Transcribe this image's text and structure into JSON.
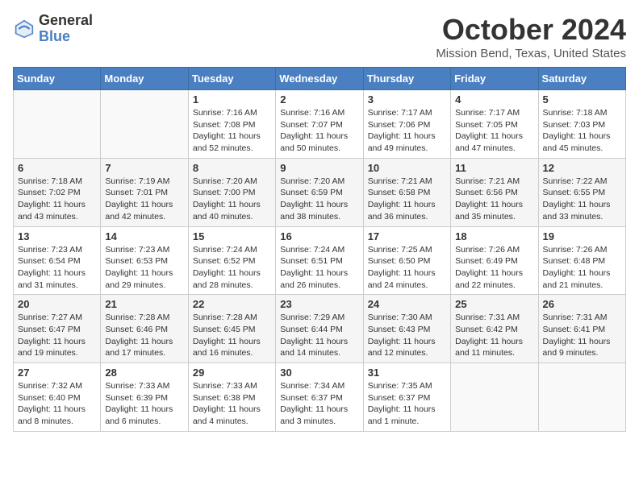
{
  "logo": {
    "general": "General",
    "blue": "Blue"
  },
  "title": "October 2024",
  "subtitle": "Mission Bend, Texas, United States",
  "headers": [
    "Sunday",
    "Monday",
    "Tuesday",
    "Wednesday",
    "Thursday",
    "Friday",
    "Saturday"
  ],
  "weeks": [
    [
      {
        "day": "",
        "sunrise": "",
        "sunset": "",
        "daylight": ""
      },
      {
        "day": "",
        "sunrise": "",
        "sunset": "",
        "daylight": ""
      },
      {
        "day": "1",
        "sunrise": "Sunrise: 7:16 AM",
        "sunset": "Sunset: 7:08 PM",
        "daylight": "Daylight: 11 hours and 52 minutes."
      },
      {
        "day": "2",
        "sunrise": "Sunrise: 7:16 AM",
        "sunset": "Sunset: 7:07 PM",
        "daylight": "Daylight: 11 hours and 50 minutes."
      },
      {
        "day": "3",
        "sunrise": "Sunrise: 7:17 AM",
        "sunset": "Sunset: 7:06 PM",
        "daylight": "Daylight: 11 hours and 49 minutes."
      },
      {
        "day": "4",
        "sunrise": "Sunrise: 7:17 AM",
        "sunset": "Sunset: 7:05 PM",
        "daylight": "Daylight: 11 hours and 47 minutes."
      },
      {
        "day": "5",
        "sunrise": "Sunrise: 7:18 AM",
        "sunset": "Sunset: 7:03 PM",
        "daylight": "Daylight: 11 hours and 45 minutes."
      }
    ],
    [
      {
        "day": "6",
        "sunrise": "Sunrise: 7:18 AM",
        "sunset": "Sunset: 7:02 PM",
        "daylight": "Daylight: 11 hours and 43 minutes."
      },
      {
        "day": "7",
        "sunrise": "Sunrise: 7:19 AM",
        "sunset": "Sunset: 7:01 PM",
        "daylight": "Daylight: 11 hours and 42 minutes."
      },
      {
        "day": "8",
        "sunrise": "Sunrise: 7:20 AM",
        "sunset": "Sunset: 7:00 PM",
        "daylight": "Daylight: 11 hours and 40 minutes."
      },
      {
        "day": "9",
        "sunrise": "Sunrise: 7:20 AM",
        "sunset": "Sunset: 6:59 PM",
        "daylight": "Daylight: 11 hours and 38 minutes."
      },
      {
        "day": "10",
        "sunrise": "Sunrise: 7:21 AM",
        "sunset": "Sunset: 6:58 PM",
        "daylight": "Daylight: 11 hours and 36 minutes."
      },
      {
        "day": "11",
        "sunrise": "Sunrise: 7:21 AM",
        "sunset": "Sunset: 6:56 PM",
        "daylight": "Daylight: 11 hours and 35 minutes."
      },
      {
        "day": "12",
        "sunrise": "Sunrise: 7:22 AM",
        "sunset": "Sunset: 6:55 PM",
        "daylight": "Daylight: 11 hours and 33 minutes."
      }
    ],
    [
      {
        "day": "13",
        "sunrise": "Sunrise: 7:23 AM",
        "sunset": "Sunset: 6:54 PM",
        "daylight": "Daylight: 11 hours and 31 minutes."
      },
      {
        "day": "14",
        "sunrise": "Sunrise: 7:23 AM",
        "sunset": "Sunset: 6:53 PM",
        "daylight": "Daylight: 11 hours and 29 minutes."
      },
      {
        "day": "15",
        "sunrise": "Sunrise: 7:24 AM",
        "sunset": "Sunset: 6:52 PM",
        "daylight": "Daylight: 11 hours and 28 minutes."
      },
      {
        "day": "16",
        "sunrise": "Sunrise: 7:24 AM",
        "sunset": "Sunset: 6:51 PM",
        "daylight": "Daylight: 11 hours and 26 minutes."
      },
      {
        "day": "17",
        "sunrise": "Sunrise: 7:25 AM",
        "sunset": "Sunset: 6:50 PM",
        "daylight": "Daylight: 11 hours and 24 minutes."
      },
      {
        "day": "18",
        "sunrise": "Sunrise: 7:26 AM",
        "sunset": "Sunset: 6:49 PM",
        "daylight": "Daylight: 11 hours and 22 minutes."
      },
      {
        "day": "19",
        "sunrise": "Sunrise: 7:26 AM",
        "sunset": "Sunset: 6:48 PM",
        "daylight": "Daylight: 11 hours and 21 minutes."
      }
    ],
    [
      {
        "day": "20",
        "sunrise": "Sunrise: 7:27 AM",
        "sunset": "Sunset: 6:47 PM",
        "daylight": "Daylight: 11 hours and 19 minutes."
      },
      {
        "day": "21",
        "sunrise": "Sunrise: 7:28 AM",
        "sunset": "Sunset: 6:46 PM",
        "daylight": "Daylight: 11 hours and 17 minutes."
      },
      {
        "day": "22",
        "sunrise": "Sunrise: 7:28 AM",
        "sunset": "Sunset: 6:45 PM",
        "daylight": "Daylight: 11 hours and 16 minutes."
      },
      {
        "day": "23",
        "sunrise": "Sunrise: 7:29 AM",
        "sunset": "Sunset: 6:44 PM",
        "daylight": "Daylight: 11 hours and 14 minutes."
      },
      {
        "day": "24",
        "sunrise": "Sunrise: 7:30 AM",
        "sunset": "Sunset: 6:43 PM",
        "daylight": "Daylight: 11 hours and 12 minutes."
      },
      {
        "day": "25",
        "sunrise": "Sunrise: 7:31 AM",
        "sunset": "Sunset: 6:42 PM",
        "daylight": "Daylight: 11 hours and 11 minutes."
      },
      {
        "day": "26",
        "sunrise": "Sunrise: 7:31 AM",
        "sunset": "Sunset: 6:41 PM",
        "daylight": "Daylight: 11 hours and 9 minutes."
      }
    ],
    [
      {
        "day": "27",
        "sunrise": "Sunrise: 7:32 AM",
        "sunset": "Sunset: 6:40 PM",
        "daylight": "Daylight: 11 hours and 8 minutes."
      },
      {
        "day": "28",
        "sunrise": "Sunrise: 7:33 AM",
        "sunset": "Sunset: 6:39 PM",
        "daylight": "Daylight: 11 hours and 6 minutes."
      },
      {
        "day": "29",
        "sunrise": "Sunrise: 7:33 AM",
        "sunset": "Sunset: 6:38 PM",
        "daylight": "Daylight: 11 hours and 4 minutes."
      },
      {
        "day": "30",
        "sunrise": "Sunrise: 7:34 AM",
        "sunset": "Sunset: 6:37 PM",
        "daylight": "Daylight: 11 hours and 3 minutes."
      },
      {
        "day": "31",
        "sunrise": "Sunrise: 7:35 AM",
        "sunset": "Sunset: 6:37 PM",
        "daylight": "Daylight: 11 hours and 1 minute."
      },
      {
        "day": "",
        "sunrise": "",
        "sunset": "",
        "daylight": ""
      },
      {
        "day": "",
        "sunrise": "",
        "sunset": "",
        "daylight": ""
      }
    ]
  ]
}
